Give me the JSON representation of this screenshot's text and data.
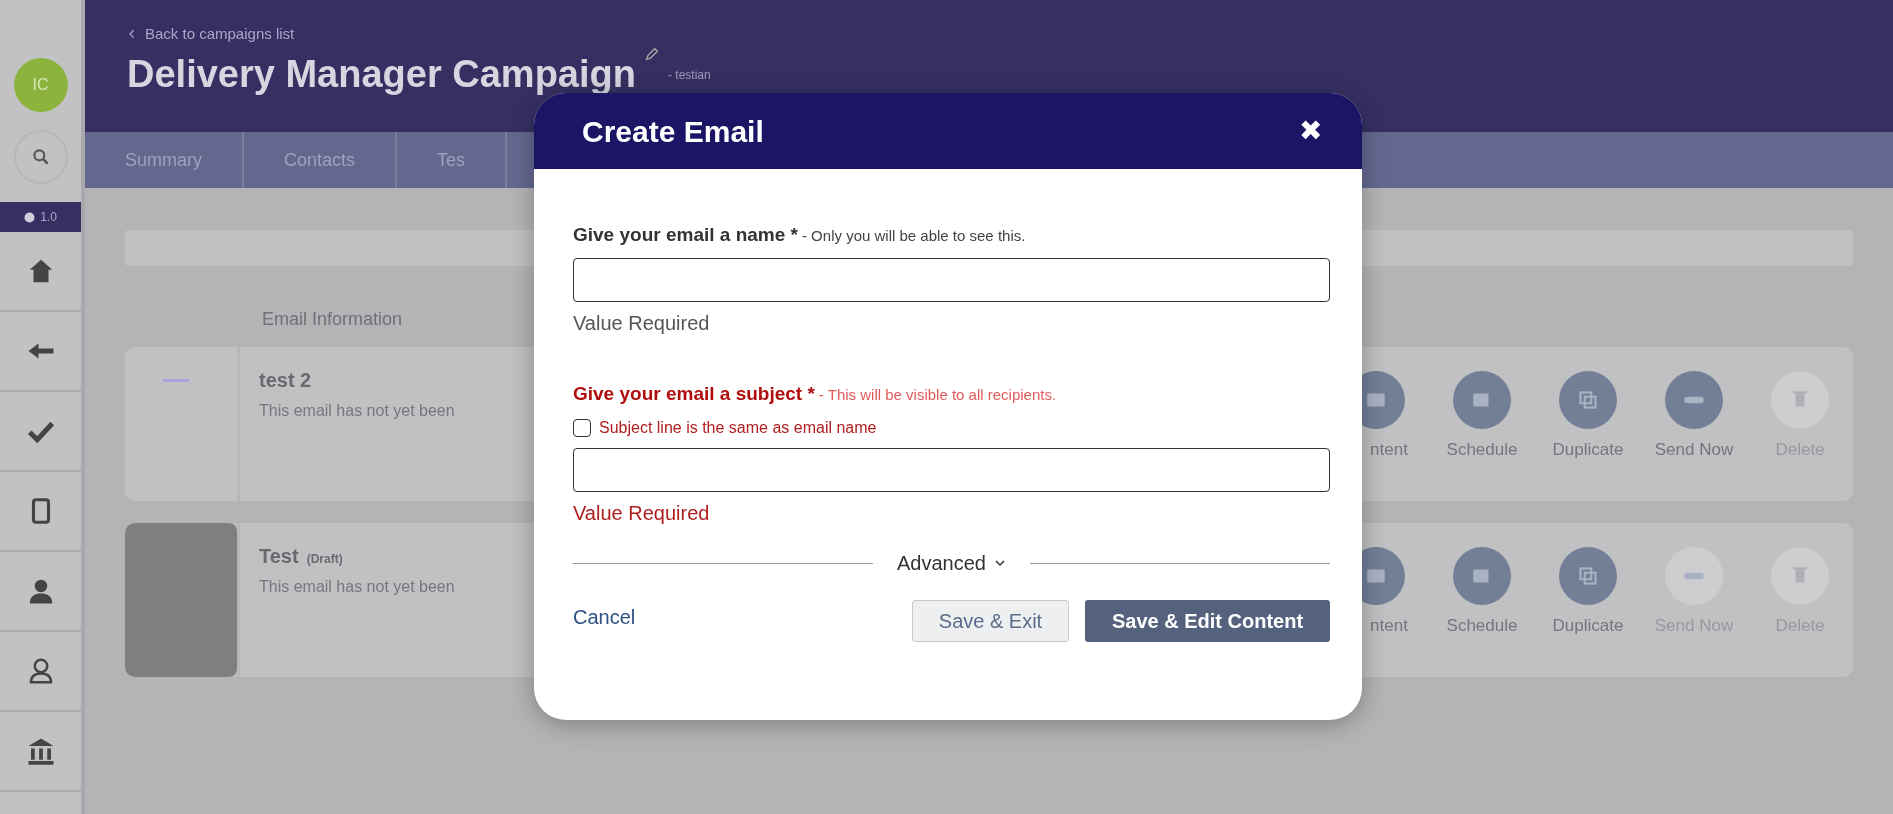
{
  "sidebar": {
    "avatar": "IC",
    "badge": "1.0"
  },
  "header": {
    "back_link": "Back to campaigns list",
    "title": "Delivery Manager Campaign",
    "subtitle": "- testian"
  },
  "tabs": [
    {
      "label": "Summary"
    },
    {
      "label": "Contacts"
    },
    {
      "label": "Tes"
    }
  ],
  "section_title": "Email Information",
  "emails": [
    {
      "name": "test 2",
      "description": "This email has not yet been",
      "kind": "empty",
      "actions": [
        {
          "label": "ntent",
          "disabled": false
        },
        {
          "label": "Schedule",
          "disabled": false
        },
        {
          "label": "Duplicate",
          "disabled": false
        },
        {
          "label": "Send Now",
          "disabled": false
        },
        {
          "label": "Delete",
          "disabled": true
        }
      ]
    },
    {
      "name": "Test",
      "status": "(Draft)",
      "description": "This email has not yet been",
      "kind": "filled",
      "actions": [
        {
          "label": "ntent",
          "disabled": false
        },
        {
          "label": "Schedule",
          "disabled": false
        },
        {
          "label": "Duplicate",
          "disabled": false
        },
        {
          "label": "Send Now",
          "disabled": true
        },
        {
          "label": "Delete",
          "disabled": true
        }
      ]
    }
  ],
  "modal": {
    "title": "Create Email",
    "close": "✖",
    "fields": [
      {
        "label": "Give your email a name *",
        "hint": "- Only you will be able to see this.",
        "error": "Value Required",
        "invalid": false
      },
      {
        "label": "Give your email a subject *",
        "hint": "- This will be visible to all recipients.",
        "checkbox": {
          "label": "Subject line is the same as email name",
          "checked": false
        },
        "error": "Value Required",
        "invalid": true
      }
    ],
    "advanced": "Advanced",
    "cancel": "Cancel",
    "buttons": [
      {
        "label": "Save & Exit",
        "kind": "secondary"
      },
      {
        "label": "Save & Edit Content",
        "kind": "primary"
      }
    ]
  }
}
